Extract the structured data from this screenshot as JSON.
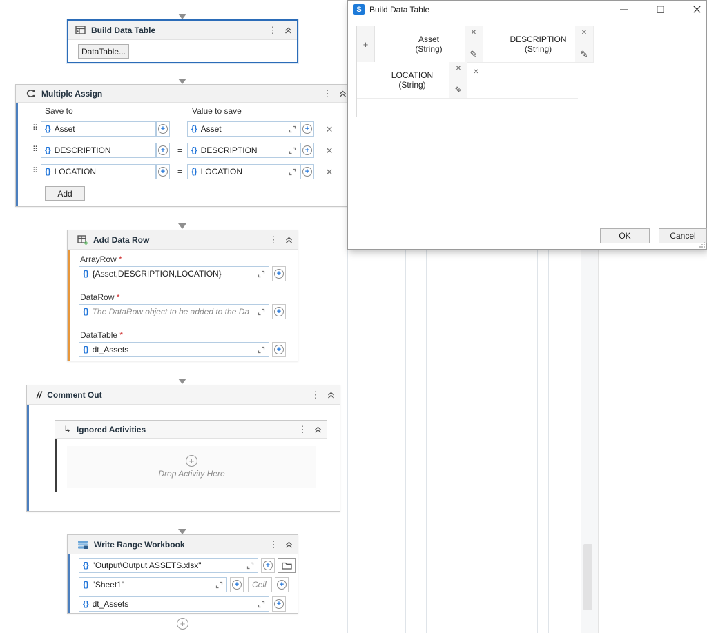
{
  "symbols": {
    "braces": "{}",
    "equals": "=",
    "asterisk": "*",
    "kebab": "⋮",
    "drag": "⠿",
    "close": "✕",
    "pencil": "✎",
    "plus": "+",
    "return_arrow": "↳",
    "comment": "//",
    "minimize": "—",
    "logo_letter": "S"
  },
  "workflow": {
    "build_data_table": {
      "title": "Build Data Table",
      "datatable_button": "DataTable..."
    },
    "multiple_assign": {
      "title": "Multiple Assign",
      "save_to_header": "Save to",
      "value_header": "Value to save",
      "rows": [
        {
          "save_to": "Asset",
          "value": "Asset"
        },
        {
          "save_to": "DESCRIPTION",
          "value": "DESCRIPTION"
        },
        {
          "save_to": "LOCATION",
          "value": "LOCATION"
        }
      ],
      "add_button": "Add"
    },
    "add_data_row": {
      "title": "Add Data Row",
      "arrayrow_label": "ArrayRow",
      "arrayrow_value": "{Asset,DESCRIPTION,LOCATION}",
      "datarow_label": "DataRow",
      "datarow_placeholder": "The DataRow object to be added to the Da",
      "datatable_label": "DataTable",
      "datatable_value": "dt_Assets"
    },
    "comment_out": {
      "title": "Comment Out",
      "ignored": {
        "title": "Ignored Activities",
        "drop_hint": "Drop Activity Here"
      }
    },
    "write_range": {
      "title": "Write Range Workbook",
      "file_value": "\"Output\\Output ASSETS.xlsx\"",
      "sheet_value": "\"Sheet1\"",
      "cell_placeholder": "Cell",
      "datatable_value": "dt_Assets"
    }
  },
  "dialog": {
    "title": "Build Data Table",
    "add_column_button": "+",
    "delete_row_button": "✕",
    "columns": [
      {
        "name": "Asset",
        "type": "(String)"
      },
      {
        "name": "DESCRIPTION",
        "type": "(String)"
      },
      {
        "name": "LOCATION",
        "type": "(String)"
      }
    ],
    "ok_button": "OK",
    "cancel_button": "Cancel"
  },
  "colors": {
    "selection": "#2b6cb8",
    "accent_blue": "#4c7fbe",
    "accent_orange": "#e8973a",
    "accent_dark": "#3c3c3c",
    "brace_blue": "#2175d9",
    "logo_blue": "#1c7ad9"
  }
}
